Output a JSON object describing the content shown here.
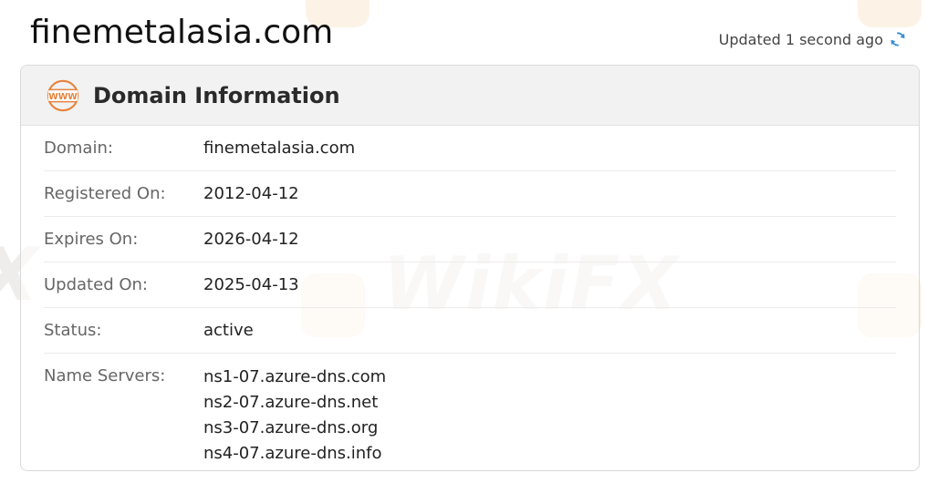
{
  "header": {
    "site_title": "finemetalasia.com",
    "updated_text": "Updated 1 second ago",
    "refresh_icon": "refresh-icon"
  },
  "card": {
    "icon": "www-icon",
    "title": "Domain Information",
    "rows": [
      {
        "label": "Domain:",
        "value": "finemetalasia.com"
      },
      {
        "label": "Registered On:",
        "value": "2012-04-12"
      },
      {
        "label": "Expires On:",
        "value": "2026-04-12"
      },
      {
        "label": "Updated On:",
        "value": "2025-04-13"
      },
      {
        "label": "Status:",
        "value": "active"
      }
    ],
    "name_servers": {
      "label": "Name Servers:",
      "values": [
        "ns1-07.azure-dns.com",
        "ns2-07.azure-dns.net",
        "ns3-07.azure-dns.org",
        "ns4-07.azure-dns.info"
      ]
    }
  },
  "watermark": {
    "text": "WikiFX",
    "text_partial": "X"
  },
  "colors": {
    "accent_orange": "#e8823a",
    "refresh_blue": "#3a8fd9",
    "header_bg": "#f2f2f2"
  }
}
